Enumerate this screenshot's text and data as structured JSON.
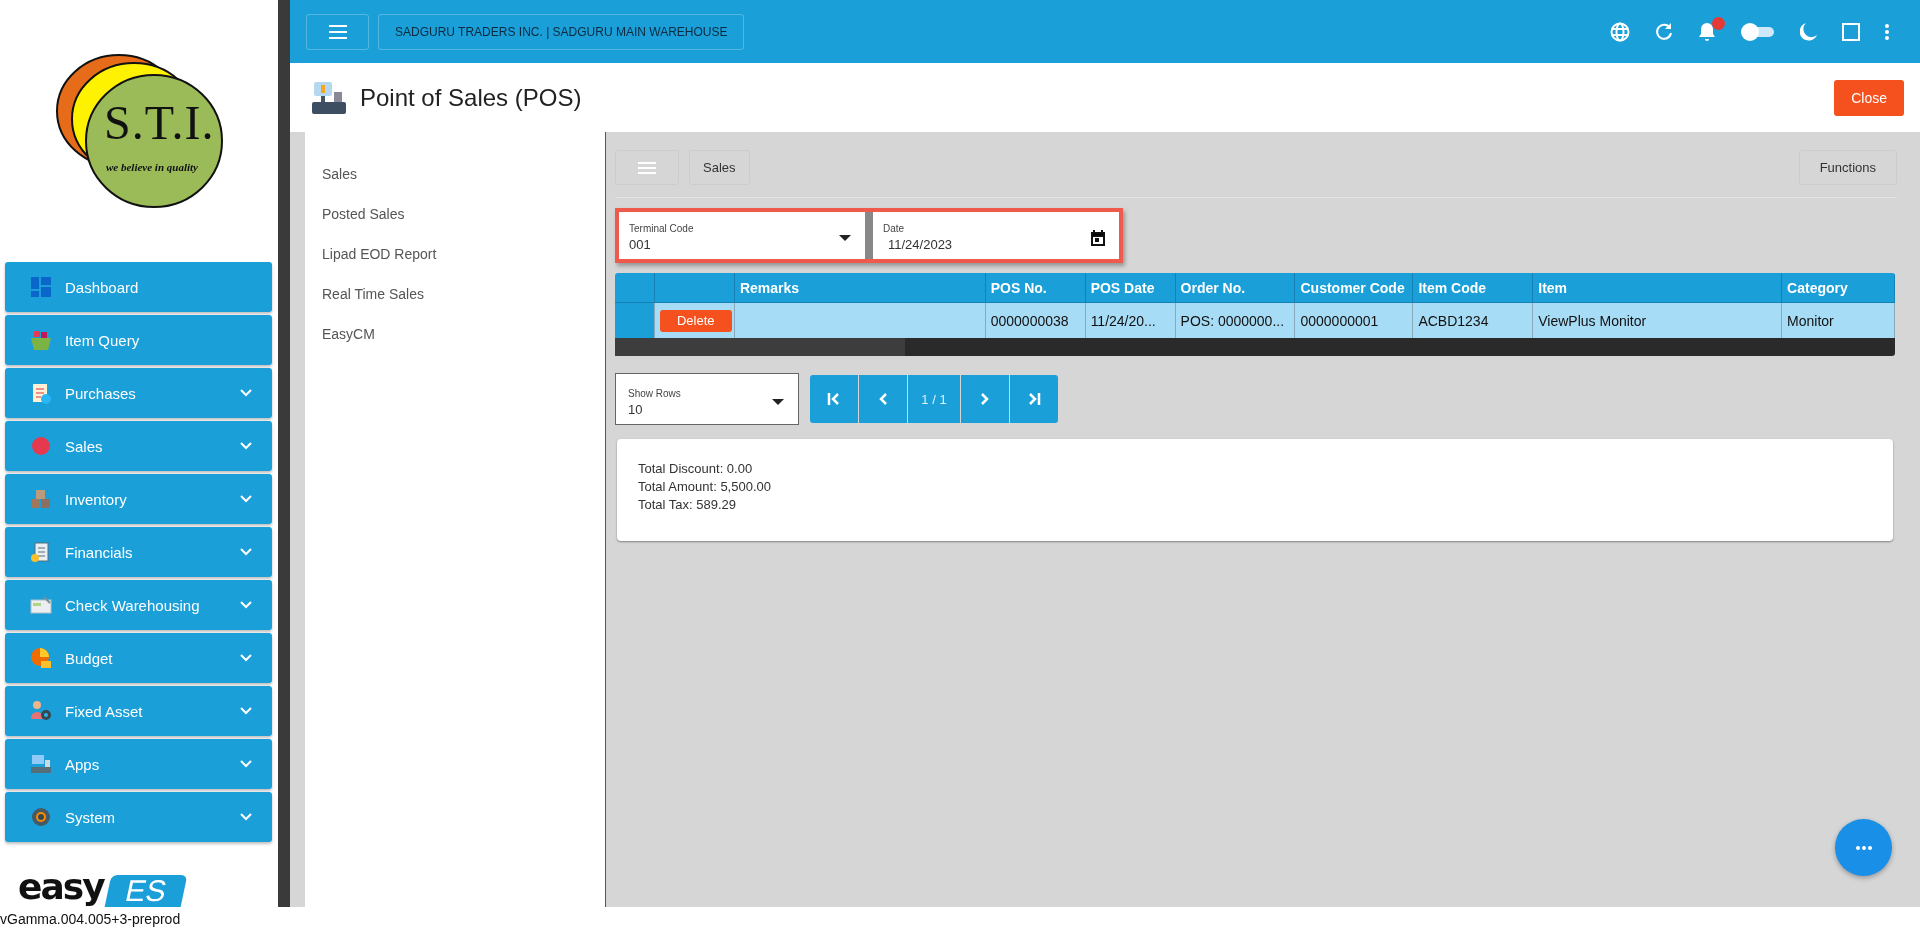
{
  "sidebar": {
    "logo": {
      "initials": "S.T.I.",
      "tagline": "we believe in quality"
    },
    "menu": [
      {
        "label": "Dashboard",
        "expandable": false
      },
      {
        "label": "Item Query",
        "expandable": false
      },
      {
        "label": "Purchases",
        "expandable": true
      },
      {
        "label": "Sales",
        "expandable": true
      },
      {
        "label": "Inventory",
        "expandable": true
      },
      {
        "label": "Financials",
        "expandable": true
      },
      {
        "label": "Check Warehousing",
        "expandable": true
      },
      {
        "label": "Budget",
        "expandable": true
      },
      {
        "label": "Fixed Asset",
        "expandable": true
      },
      {
        "label": "Apps",
        "expandable": true
      },
      {
        "label": "System",
        "expandable": true
      }
    ],
    "brand": {
      "word": "easy",
      "tag": "ES"
    }
  },
  "header": {
    "company": "SADGURU TRADERS INC. | SADGURU MAIN WAREHOUSE",
    "notification_badge": true
  },
  "page": {
    "title": "Point of Sales (POS)",
    "close_button": "Close"
  },
  "nav": [
    {
      "label": "Sales"
    },
    {
      "label": "Posted Sales"
    },
    {
      "label": "Lipad EOD Report"
    },
    {
      "label": "Real Time Sales"
    },
    {
      "label": "EasyCM"
    }
  ],
  "toolbar": {
    "breadcrumb": "Sales",
    "functions_button": "Functions"
  },
  "filters": [
    {
      "kind": "dropdown",
      "label": "Terminal Code",
      "value": "001"
    },
    {
      "kind": "date",
      "label": "Date",
      "value": "11/24/2023"
    }
  ],
  "table": {
    "columns": [
      "Remarks",
      "POS No.",
      "POS Date",
      "Order No.",
      "Customer Code",
      "Item Code",
      "Item",
      "Category"
    ],
    "rows": [
      {
        "selected": true,
        "action": "Delete",
        "cells": [
          "",
          "0000000038",
          "11/24/20...",
          "POS: 0000000...",
          "0000000001",
          "ACBD1234",
          "ViewPlus Monitor",
          "Monitor"
        ]
      }
    ]
  },
  "pager": {
    "show_rows_label": "Show Rows",
    "show_rows_value": "10",
    "page": "1 / 1"
  },
  "totals": [
    "Total Discount: 0.00",
    "Total Amount: 5,500.00",
    "Total Tax: 589.29"
  ],
  "version": "vGamma.004.005+3-preprod"
}
